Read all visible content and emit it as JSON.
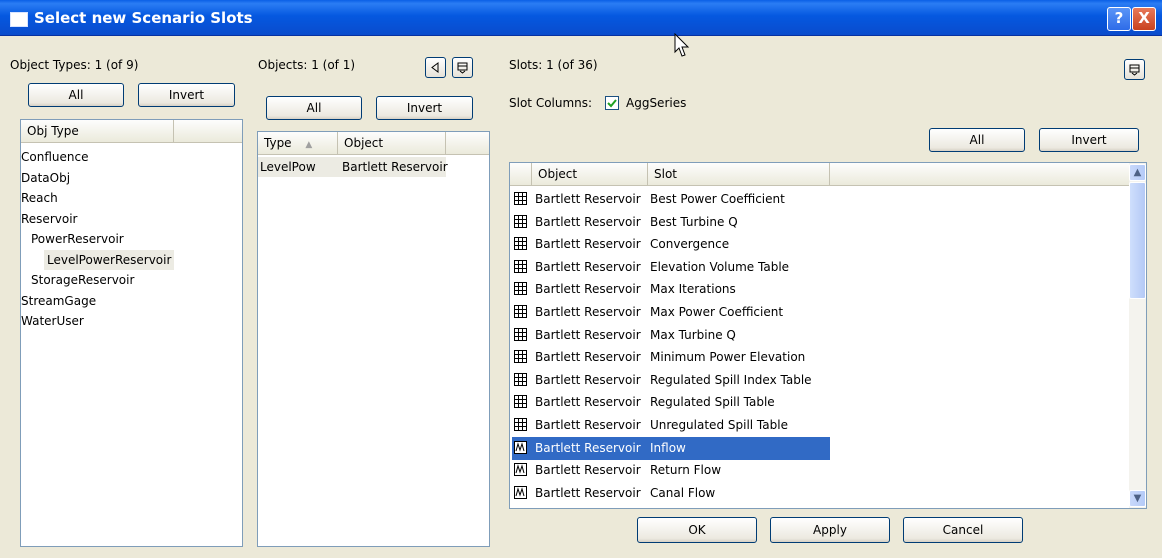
{
  "window": {
    "title": "Select new Scenario Slots",
    "help_label": "?",
    "close_label": "X"
  },
  "object_types": {
    "label": "Object Types: 1 (of 9)",
    "all_label": "All",
    "invert_label": "Invert",
    "column_header": "Obj Type",
    "items": [
      {
        "label": "Confluence"
      },
      {
        "label": "DataObj"
      },
      {
        "label": "Reach"
      },
      {
        "label": "Reservoir"
      },
      {
        "label": "PowerReservoir"
      },
      {
        "label": "LevelPowerReservoir"
      },
      {
        "label": "StorageReservoir"
      },
      {
        "label": "StreamGage"
      },
      {
        "label": "WaterUser"
      }
    ],
    "selected": "LevelPowerReservoir"
  },
  "objects": {
    "label": "Objects: 1 (of 1)",
    "all_label": "All",
    "invert_label": "Invert",
    "col_type": "Type",
    "col_object": "Object",
    "rows": [
      {
        "type": "LevelPow",
        "object": "Bartlett Reservoir"
      }
    ]
  },
  "slots": {
    "label": "Slots: 1 (of 36)",
    "slot_columns_label": "Slot Columns:",
    "aggseries_label": "AggSeries",
    "aggseries_checked": true,
    "all_label": "All",
    "invert_label": "Invert",
    "col_object": "Object",
    "col_slot": "Slot",
    "rows": [
      {
        "object": "Bartlett Reservoir",
        "slot": "Best Power Coefficient",
        "icon": "table-grid-icon"
      },
      {
        "object": "Bartlett Reservoir",
        "slot": "Best Turbine Q",
        "icon": "table-grid-icon"
      },
      {
        "object": "Bartlett Reservoir",
        "slot": "Convergence",
        "icon": "table-grid-icon"
      },
      {
        "object": "Bartlett Reservoir",
        "slot": "Elevation Volume Table",
        "icon": "table-grid-icon"
      },
      {
        "object": "Bartlett Reservoir",
        "slot": "Max Iterations",
        "icon": "table-grid-icon"
      },
      {
        "object": "Bartlett Reservoir",
        "slot": "Max Power Coefficient",
        "icon": "table-grid-icon"
      },
      {
        "object": "Bartlett Reservoir",
        "slot": "Max Turbine Q",
        "icon": "table-grid-icon"
      },
      {
        "object": "Bartlett Reservoir",
        "slot": "Minimum Power Elevation",
        "icon": "table-grid-icon"
      },
      {
        "object": "Bartlett Reservoir",
        "slot": "Regulated Spill Index Table",
        "icon": "table-grid-icon"
      },
      {
        "object": "Bartlett Reservoir",
        "slot": "Regulated Spill Table",
        "icon": "table-grid-icon"
      },
      {
        "object": "Bartlett Reservoir",
        "slot": "Unregulated Spill Table",
        "icon": "table-grid-icon"
      },
      {
        "object": "Bartlett Reservoir",
        "slot": "Inflow",
        "icon": "series-wave-icon"
      },
      {
        "object": "Bartlett Reservoir",
        "slot": "Return Flow",
        "icon": "series-wave-icon"
      },
      {
        "object": "Bartlett Reservoir",
        "slot": "Canal Flow",
        "icon": "series-wave-icon"
      }
    ],
    "selected": "Inflow"
  },
  "footer": {
    "ok_label": "OK",
    "apply_label": "Apply",
    "cancel_label": "Cancel"
  },
  "colors": {
    "titlebar": "#0a4ccc",
    "selection": "#316ac5",
    "dialog_bg": "#ece9d8"
  }
}
